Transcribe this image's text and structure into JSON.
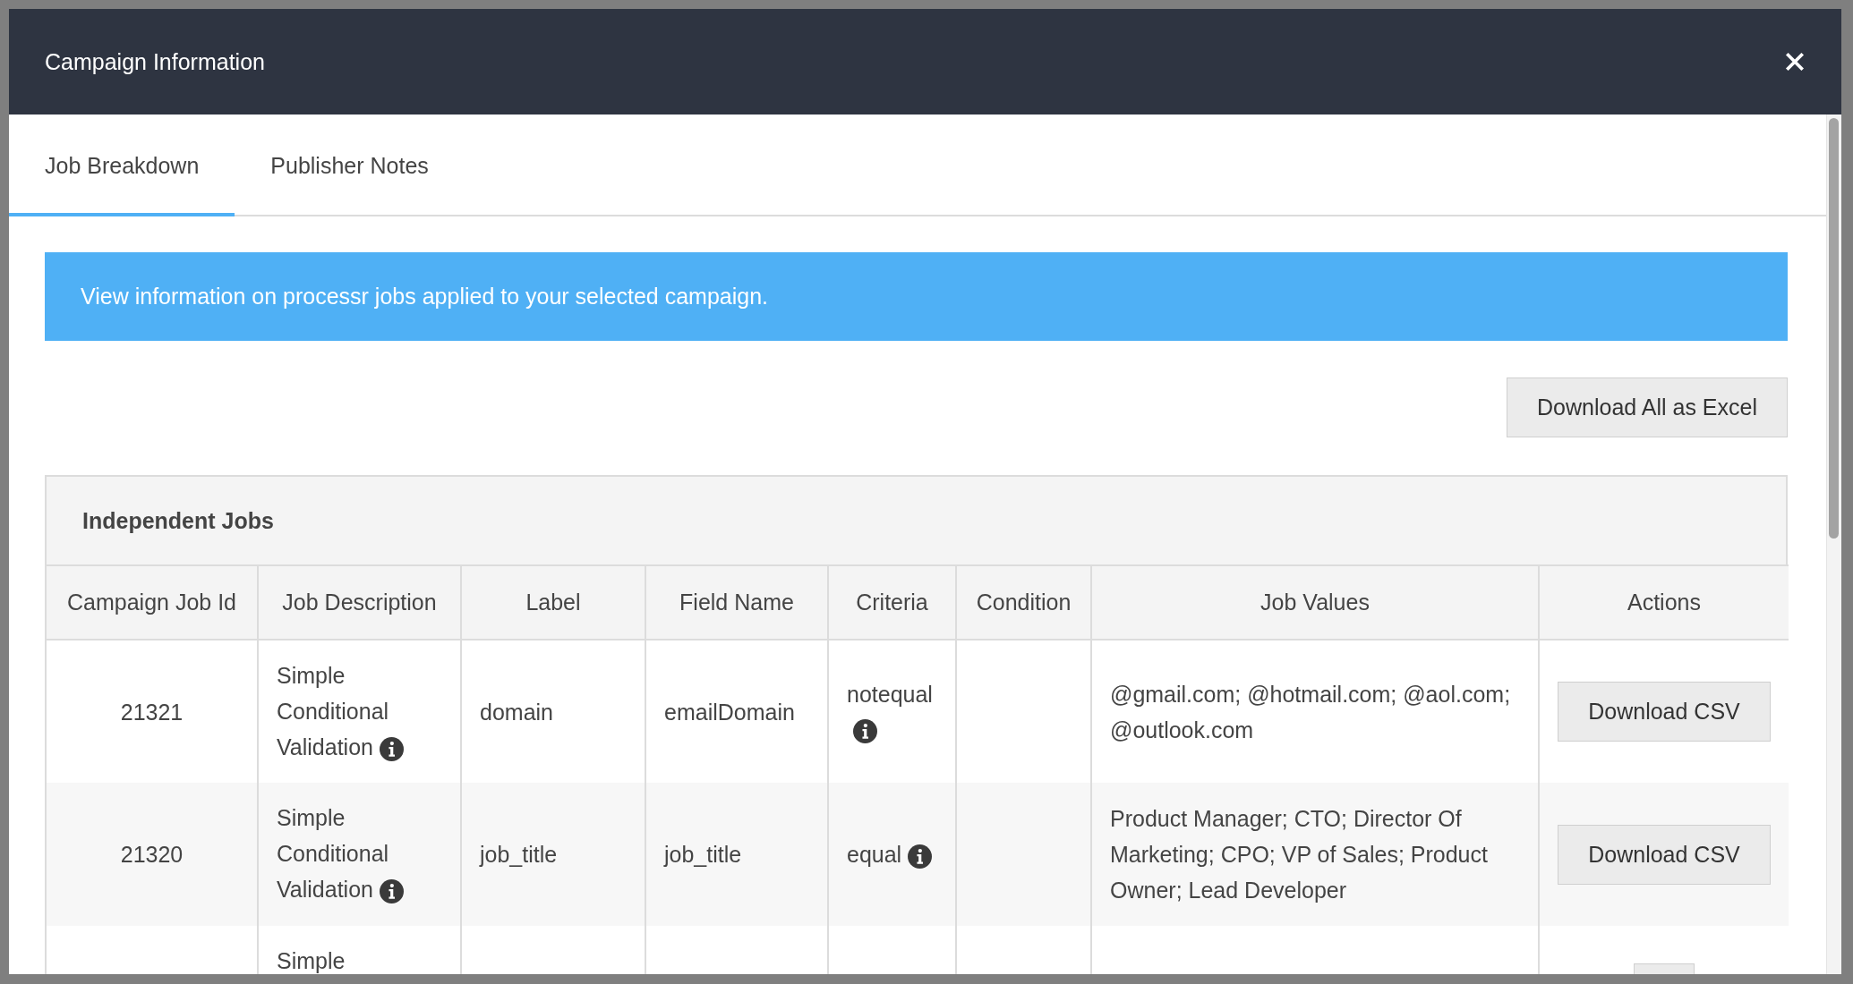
{
  "dialog": {
    "title": "Campaign Information",
    "tabs": [
      {
        "label": "Job Breakdown",
        "selected": true
      },
      {
        "label": "Publisher Notes",
        "selected": false
      }
    ],
    "info_banner": "View information on processr jobs applied to your selected campaign.",
    "download_all_button": "Download All as Excel",
    "panel": {
      "title": "Independent Jobs",
      "columns": [
        "Campaign Job Id",
        "Job Description",
        "Label",
        "Field Name",
        "Criteria",
        "Condition",
        "Job Values",
        "Actions"
      ],
      "rows": [
        {
          "campaign_job_id": "21321",
          "job_description": "Simple Conditional Validation",
          "description_info": true,
          "label": "domain",
          "field_name": "emailDomain",
          "criteria": "notequal",
          "criteria_info": true,
          "job_values": "@gmail.com; @hotmail.com; @aol.com; @outlook.com",
          "action": "Download CSV"
        },
        {
          "campaign_job_id": "21320",
          "job_description": "Simple Conditional Validation",
          "description_info": true,
          "label": "job_title",
          "field_name": "job_title",
          "criteria": "equal",
          "criteria_info": true,
          "job_values": "Product Manager; CTO; Director Of Marketing; CPO; VP of Sales; Product Owner; Lead Developer",
          "action": "Download CSV"
        },
        {
          "job_description": "Simple"
        }
      ]
    }
  }
}
